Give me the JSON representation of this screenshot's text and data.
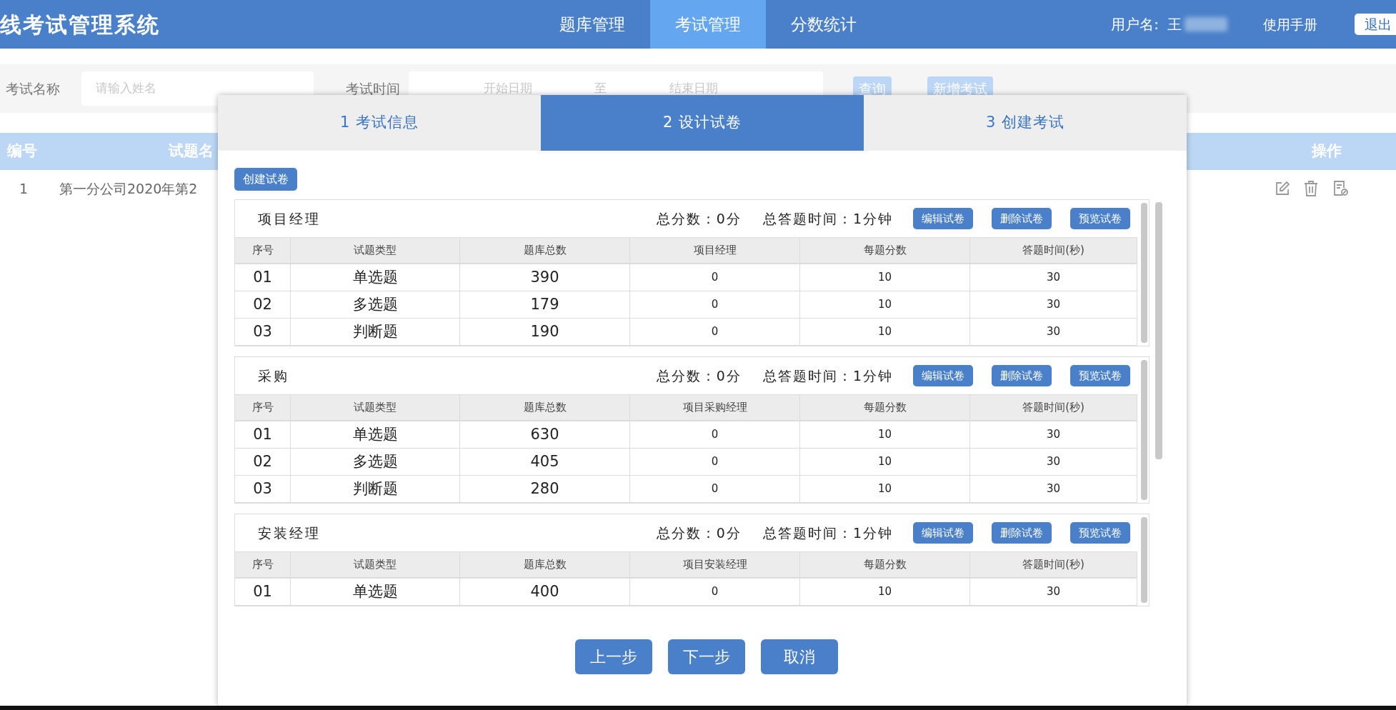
{
  "header": {
    "title": "线考试管理系统",
    "nav": [
      {
        "label": "题库管理",
        "selected": false
      },
      {
        "label": "考试管理",
        "selected": true
      },
      {
        "label": "分数统计",
        "selected": false
      }
    ],
    "user_label": "用户名:",
    "user_name": "王",
    "manual_link": "使用手册",
    "logout_button": "退出"
  },
  "filter": {
    "name_label": "考试名称",
    "name_placeholder": "请输入姓名",
    "time_label": "考试时间",
    "start_placeholder": "开始日期",
    "separator": "至",
    "end_placeholder": "结束日期",
    "buttons": [
      "查询",
      "新增考试"
    ]
  },
  "table": {
    "columns": [
      "编号",
      "试题名",
      "操作"
    ],
    "rows": [
      {
        "cells": [
          "1",
          "第一分公司2020年第2"
        ]
      }
    ]
  },
  "dialog": {
    "steps": [
      {
        "label": "1 考试信息",
        "selected": false
      },
      {
        "label": "2 设计试卷",
        "selected": true
      },
      {
        "label": "3 创建考试",
        "selected": false
      }
    ],
    "create_button": "创建试卷",
    "papers": [
      {
        "name": "项目经理",
        "total_score": "总分数：0分",
        "total_time": "总答题时间：1分钟",
        "actions": [
          "编辑试卷",
          "删除试卷",
          "预览试卷"
        ],
        "columns": [
          "序号",
          "试题类型",
          "题库总数",
          "项目经理",
          "每题分数",
          "答题时间(秒)"
        ],
        "rows": [
          [
            "01",
            "单选题",
            "390",
            "0",
            "10",
            "30"
          ],
          [
            "02",
            "多选题",
            "179",
            "0",
            "10",
            "30"
          ],
          [
            "03",
            "判断题",
            "190",
            "0",
            "10",
            "30"
          ]
        ]
      },
      {
        "name": "采购",
        "total_score": "总分数：0分",
        "total_time": "总答题时间：1分钟",
        "actions": [
          "编辑试卷",
          "删除试卷",
          "预览试卷"
        ],
        "columns": [
          "序号",
          "试题类型",
          "题库总数",
          "项目采购经理",
          "每题分数",
          "答题时间(秒)"
        ],
        "rows": [
          [
            "01",
            "单选题",
            "630",
            "0",
            "10",
            "30"
          ],
          [
            "02",
            "多选题",
            "405",
            "0",
            "10",
            "30"
          ],
          [
            "03",
            "判断题",
            "280",
            "0",
            "10",
            "30"
          ]
        ]
      },
      {
        "name": "安装经理",
        "total_score": "总分数：0分",
        "total_time": "总答题时间：1分钟",
        "actions": [
          "编辑试卷",
          "删除试卷",
          "预览试卷"
        ],
        "columns": [
          "序号",
          "试题类型",
          "题库总数",
          "项目安装经理",
          "每题分数",
          "答题时间(秒)"
        ],
        "rows": [
          [
            "01",
            "单选题",
            "400",
            "0",
            "10",
            "30"
          ]
        ]
      }
    ],
    "footer_buttons": [
      "上一步",
      "下一步",
      "取消"
    ]
  }
}
